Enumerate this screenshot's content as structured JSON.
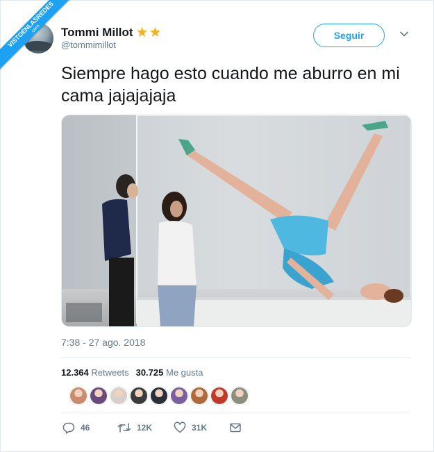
{
  "watermark": {
    "line1": "VISTOENLASREDES",
    "line2": ".com"
  },
  "user": {
    "name": "Tommi Millot",
    "badges": "★★",
    "handle": "@tommimillot",
    "avatar_icon": "profile-photo"
  },
  "follow_button": {
    "label": "Seguir"
  },
  "menu_icon": "chevron-down-icon",
  "tweet": {
    "text": "Siempre hago esto cuando me aburro en mi cama jajajajaja",
    "media_icon": "photo-woman-posing-in-glass-box",
    "timestamp": "7:38 - 27 ago. 2018"
  },
  "stats": {
    "retweets_count": "12.364",
    "retweets_label": "Retweets",
    "likes_count": "30.725",
    "likes_label": "Me gusta"
  },
  "liker_avatars": [
    "#c98b6b",
    "#6a4a7a",
    "#d8d0c8",
    "#3c3c3c",
    "#2a2f3a",
    "#7b5e9e",
    "#b06a3a",
    "#c0392b",
    "#8e8e7e"
  ],
  "actions": {
    "reply_count": "46",
    "retweet_count": "12K",
    "like_count": "31K",
    "reply_icon": "reply-icon",
    "retweet_icon": "retweet-icon",
    "like_icon": "heart-icon",
    "dm_icon": "envelope-icon"
  },
  "colors": {
    "accent": "#1da1f2",
    "badge_star": "#f2b01e",
    "secondary_text": "#657786",
    "primary_text": "#14171a"
  }
}
